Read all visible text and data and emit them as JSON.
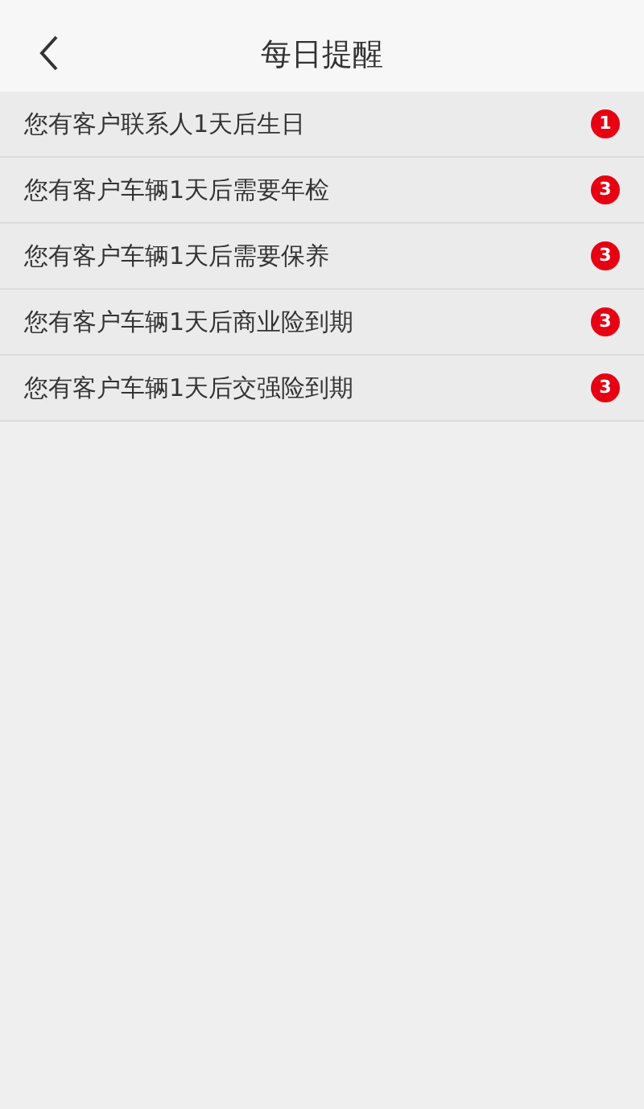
{
  "header": {
    "title": "每日提醒"
  },
  "reminders": [
    {
      "text": "您有客户联系人1天后生日",
      "count": "1"
    },
    {
      "text": "您有客户车辆1天后需要年检",
      "count": "3"
    },
    {
      "text": "您有客户车辆1天后需要保养",
      "count": "3"
    },
    {
      "text": "您有客户车辆1天后商业险到期",
      "count": "3"
    },
    {
      "text": "您有客户车辆1天后交强险到期",
      "count": "3"
    }
  ]
}
